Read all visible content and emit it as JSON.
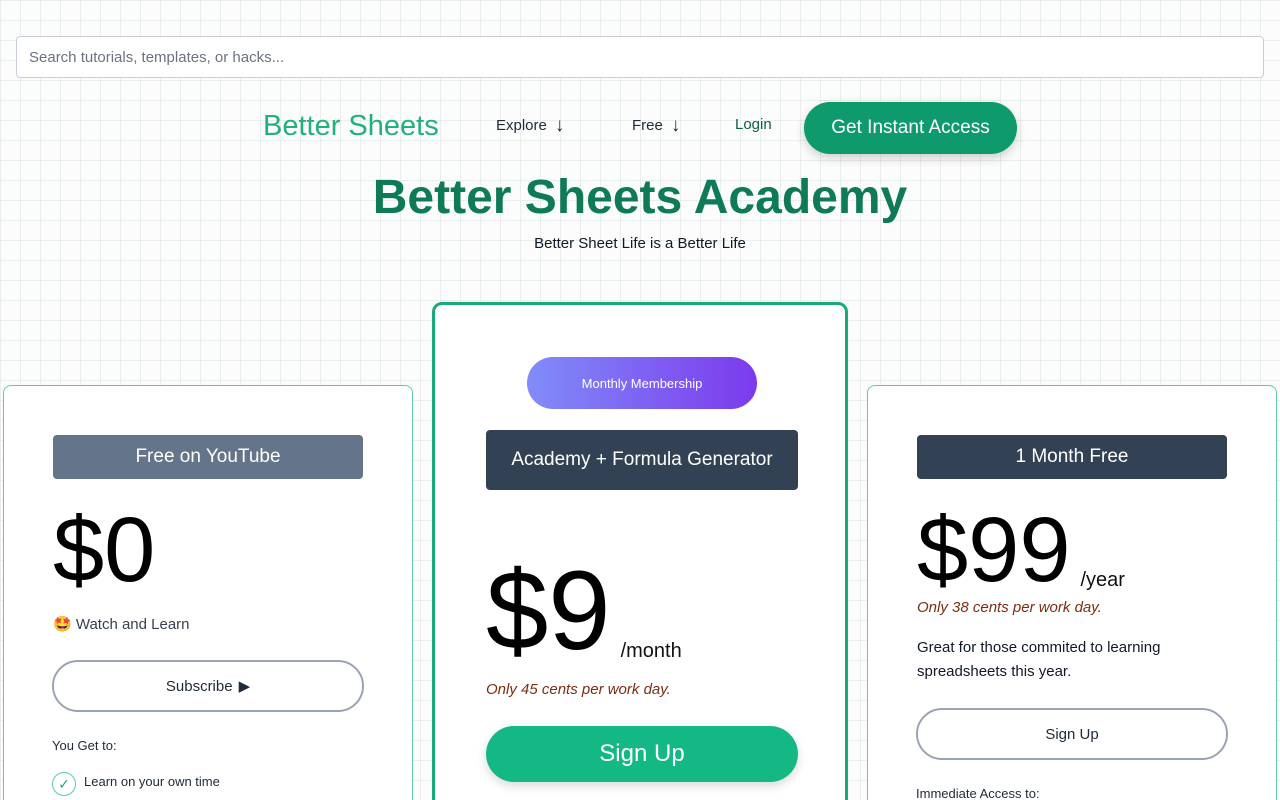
{
  "search": {
    "placeholder": "Search tutorials, templates, or hacks..."
  },
  "nav": {
    "brand": "Better Sheets",
    "explore": "Explore",
    "free": "Free",
    "arrow": "↓",
    "login": "Login",
    "cta": "Get Instant Access"
  },
  "hero": {
    "title": "Better Sheets Academy",
    "subtitle": "Better Sheet Life is a Better Life"
  },
  "plans": {
    "free": {
      "label": "Free on YouTube",
      "price": "$0",
      "tagline": "🤩 Watch and Learn",
      "button": "Subscribe",
      "button_icon": "▶",
      "you_get": "You Get to:",
      "features": [
        "Learn on your own time"
      ]
    },
    "monthly": {
      "badge": "Monthly Membership",
      "label": "Academy + Formula Generator",
      "price": "$9",
      "per": "/month",
      "note": "Only 45 cents per work day.",
      "button": "Sign Up"
    },
    "yearly": {
      "label": "1 Month Free",
      "price": "$99",
      "per": "/year",
      "note": "Only 38 cents per work day.",
      "description": "Great for those commited to learning spreadsheets this year.",
      "button": "Sign Up",
      "access": "Immediate Access to:"
    }
  },
  "colors": {
    "brand": "#22b07d",
    "accent": "#0e9a6c",
    "heading": "#0e7a57",
    "label_dark": "#334155",
    "label_slate": "#64748b",
    "note": "#7c2d12"
  },
  "icons": {
    "check": "check-icon",
    "play": "play-icon",
    "arrow_down": "arrow-down-icon"
  }
}
